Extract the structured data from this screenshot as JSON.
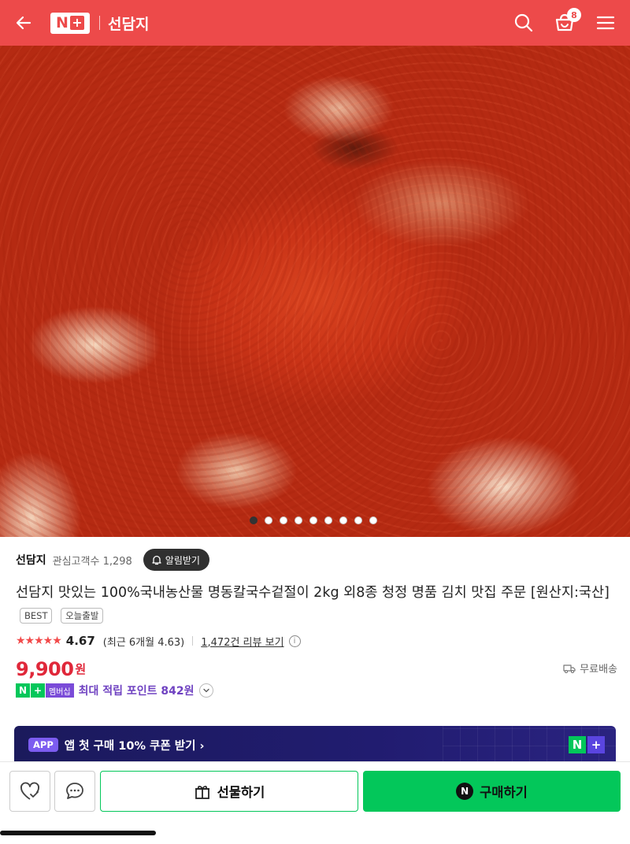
{
  "header": {
    "logo_n": "N",
    "logo_plus": "+",
    "store_title": "선담지",
    "cart_count": "8",
    "bg_color": "#ed4a4a"
  },
  "gallery": {
    "image_subject": "kimchi close-up",
    "total_images": 9,
    "active_index": 0
  },
  "product": {
    "store_name": "선담지",
    "fans": "관심고객수 1,298",
    "alarm_label": "알림받기",
    "title": "선담지 맛있는 100%국내농산물 명동칼국수겉절이 2kg 외8종 청정 명품 김치 맛집 주문 [원산지:국산]",
    "tags": [
      "BEST",
      "오늘출발"
    ],
    "stars": "★★★★★",
    "rating": "4.67",
    "recent_rating": "(최근 6개월 4.63)",
    "review_link": "1,472건 리뷰 보기",
    "info_icon": "i",
    "price": "9,900",
    "currency": "원",
    "shipping": "무료배송",
    "membership_badge": "멤버십",
    "point_text": "최대 적립 포인트 842원"
  },
  "banner": {
    "chip": "APP",
    "text": "앱 첫 구매 10% 쿠폰 받기 ›",
    "logo_n": "N",
    "logo_plus": "+"
  },
  "actions": {
    "gift_label": "선물하기",
    "buy_label": "구매하기",
    "buy_icon_letter": "N",
    "accent_green": "#03c75a"
  }
}
